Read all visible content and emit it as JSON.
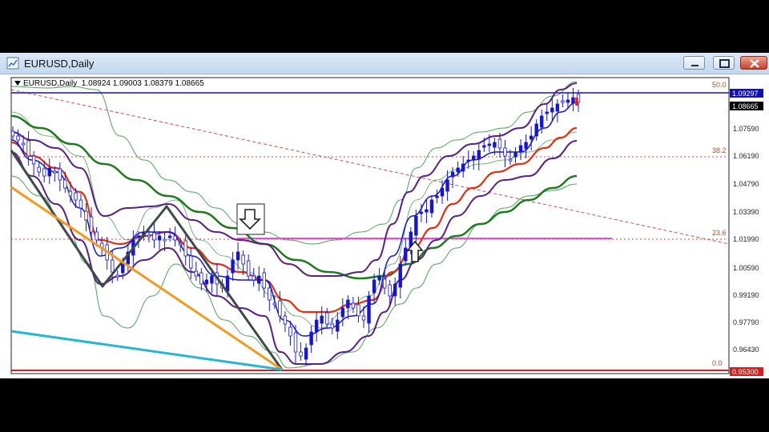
{
  "window": {
    "title": "EURUSD,Daily",
    "controls": [
      "minimize",
      "maximize",
      "close"
    ]
  },
  "chart_header": {
    "symbol": "EURUSD,Daily",
    "ohlc": "1.08924 1.09003 1.08379 1.08665"
  },
  "price_axis": {
    "ticks": [
      "1.07590",
      "1.06190",
      "1.04790",
      "1.03390",
      "1.01990",
      "1.00590",
      "0.99190",
      "0.97790",
      "0.96430"
    ],
    "highlight_top": "1.09297",
    "current_price": "1.08665",
    "highlight_bottom": "0.95300"
  },
  "fibo_levels": [
    "50.0",
    "38.2",
    "23.6",
    "0.0"
  ],
  "colors": {
    "candle": "#1515d8",
    "ma_short": "#e03010",
    "ma_long": "#1d7a1d",
    "bands": "#5a1e84",
    "outer_bands": "#4aa35a",
    "trend_orange": "#f39a1e",
    "trend_cyan": "#25b7cf",
    "trend_dark": "#3f4a4a",
    "fib_line": "#e94ad6",
    "support_line": "#d02020",
    "resistance_line": "#1010c0"
  },
  "icons": [
    "arrow-down-box-icon",
    "arrow-up-outline-icon"
  ]
}
